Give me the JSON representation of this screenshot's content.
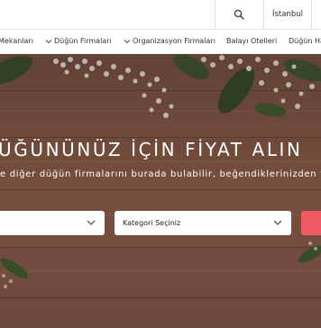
{
  "topbar": {
    "search_icon": "search-icon",
    "city": "İstanbul"
  },
  "nav": {
    "items": [
      {
        "label": "Mekanları",
        "has_chevron": false
      },
      {
        "label": "Düğün Firmaları",
        "has_chevron": true
      },
      {
        "label": "Organizasyon Firmaları",
        "has_chevron": true
      },
      {
        "label": "Balayı Otelleri",
        "has_chevron": false
      },
      {
        "label": "Düğün Ha",
        "has_chevron": false
      }
    ]
  },
  "hero": {
    "title": "ÜĞÜNÜNÜZ İÇİN FİYAT ALIN",
    "subtitle": "e diğer düğün firmalarını burada bulabilir, beğendiklerinizden fiyat teklif",
    "location_select": {
      "value": ""
    },
    "category_select": {
      "value": "Kategori Seçiniz"
    }
  },
  "colors": {
    "accent": "#f25a63",
    "wood": "#7d5443",
    "leaf": "#2f4a22",
    "flower": "#f3f0e6"
  }
}
